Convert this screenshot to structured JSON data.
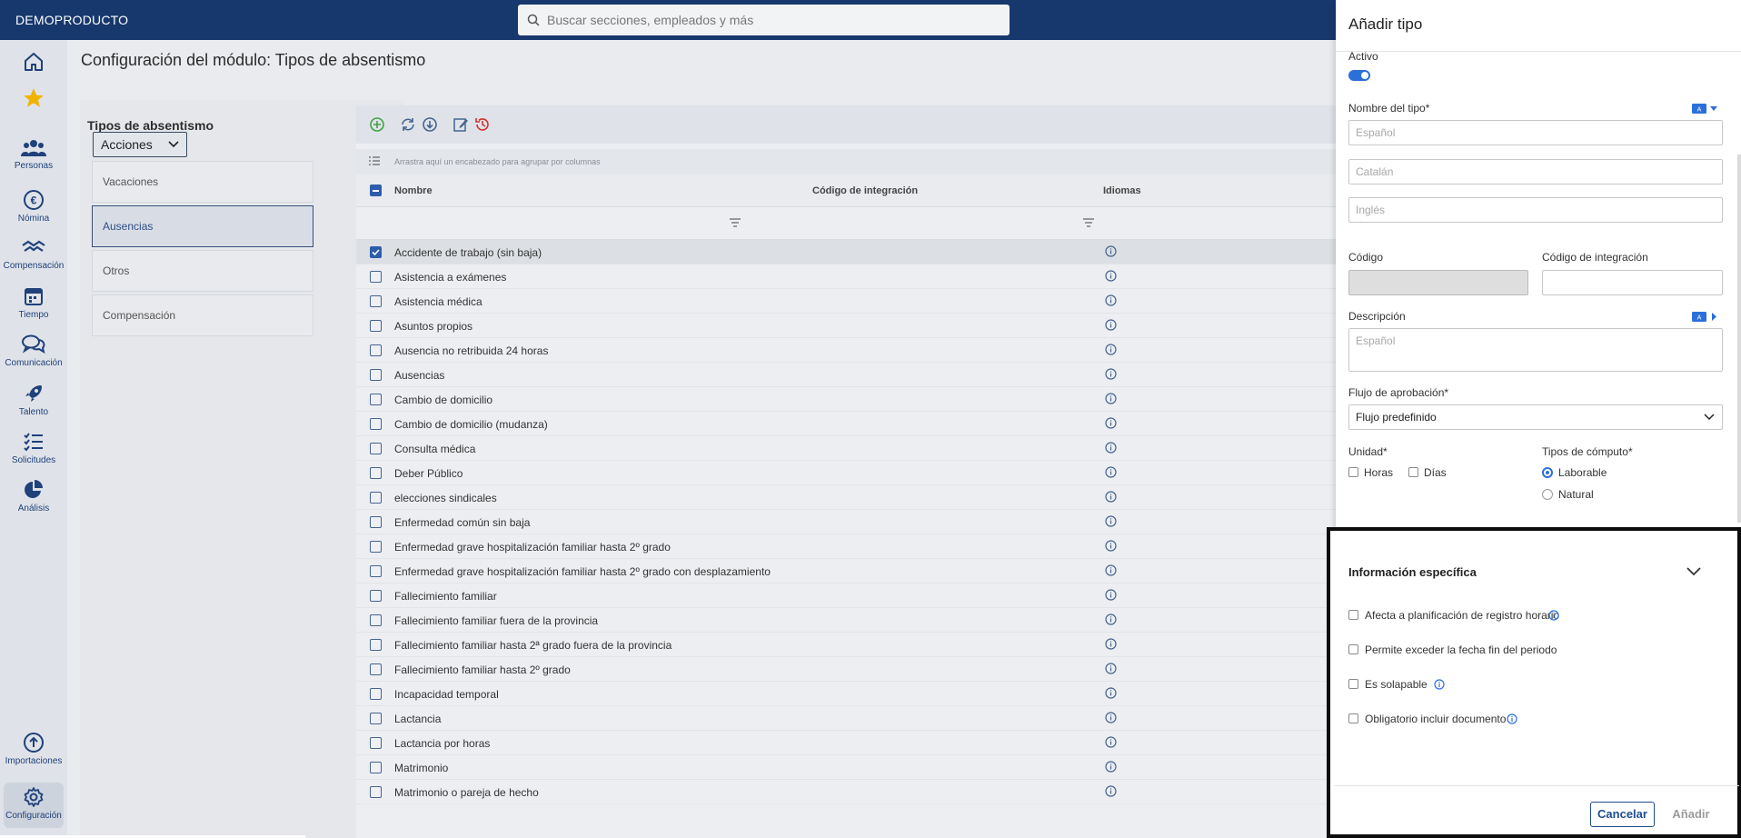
{
  "brand": "DEMOPRODUCTO",
  "search": {
    "placeholder": "Buscar secciones, empleados y más"
  },
  "sidebar": {
    "items": [
      {
        "label": "",
        "icon": "home-icon"
      },
      {
        "label": "",
        "icon": "star-icon"
      },
      {
        "label": "Personas",
        "icon": "people-icon"
      },
      {
        "label": "Nómina",
        "icon": "euro-icon"
      },
      {
        "label": "Compensación",
        "icon": "handshake-icon"
      },
      {
        "label": "Tiempo",
        "icon": "calendar-icon"
      },
      {
        "label": "Comunicación",
        "icon": "chat-icon"
      },
      {
        "label": "Talento",
        "icon": "rocket-icon"
      },
      {
        "label": "Solicitudes",
        "icon": "checklist-icon"
      },
      {
        "label": "Análisis",
        "icon": "pie-chart-icon"
      },
      {
        "label": "Importaciones",
        "icon": "upload-icon"
      },
      {
        "label": "Configuración",
        "icon": "gear-icon"
      }
    ]
  },
  "page": {
    "title": "Configuración del módulo: Tipos de absentismo"
  },
  "left_panel": {
    "title": "Tipos de absentismo",
    "acciones": "Acciones",
    "types": [
      "Vacaciones",
      "Ausencias",
      "Otros",
      "Compensación"
    ],
    "active_type": "Ausencias"
  },
  "grid": {
    "group_hint": "Arrastra aquí un encabezado para agrupar por columnas",
    "columns": [
      "Nombre",
      "Código de integración",
      "Idiomas"
    ],
    "rows": [
      "Accidente de trabajo (sin baja)",
      "Asistencia a exámenes",
      "Asistencia médica",
      "Asuntos propios",
      "Ausencia no retribuida 24 horas",
      "Ausencias",
      "Cambio de domicilio",
      "Cambio de domicilio (mudanza)",
      "Consulta médica",
      "Deber Público",
      "elecciones sindicales",
      "Enfermedad común sin baja",
      "Enfermedad grave hospitalización familiar hasta 2º grado",
      "Enfermedad grave hospitalización familiar hasta 2º grado con desplazamiento",
      "Fallecimiento familiar",
      "Fallecimiento familiar fuera de la provincia",
      "Fallecimiento familiar hasta 2ª grado fuera de la provincia",
      "Fallecimiento familiar hasta 2º grado",
      "Incapacidad temporal",
      "Lactancia",
      "Lactancia por horas",
      "Matrimonio",
      "Matrimonio o pareja de hecho"
    ],
    "selected_row": 0
  },
  "form": {
    "title": "Añadir tipo",
    "activo_label": "Activo",
    "activo": true,
    "nombre_label": "Nombre del tipo*",
    "nombre_placeholders": [
      "Español",
      "Catalán",
      "Inglés"
    ],
    "codigo_label": "Código",
    "codigo_integracion_label": "Código de integración",
    "descripcion_label": "Descripción",
    "descripcion_placeholder": "Español",
    "flujo_label": "Flujo de aprobación*",
    "flujo_value": "Flujo predefinido",
    "unidad_label": "Unidad*",
    "unidad_options": [
      "Horas",
      "Días"
    ],
    "computo_label": "Tipos de cómputo*",
    "computo_options": [
      "Laborable",
      "Natural"
    ],
    "computo_selected": "Laborable",
    "section_title": "Información específica",
    "checks": [
      "Afecta a planificación de registro horario",
      "Permite exceder la fecha fin del periodo",
      "Es solapable",
      "Obligatorio incluir documento"
    ],
    "cancel": "Cancelar",
    "add": "Añadir"
  },
  "colors": {
    "brand": "#17386d",
    "accent": "#2b6fd9",
    "nav_text": "#20417a"
  }
}
